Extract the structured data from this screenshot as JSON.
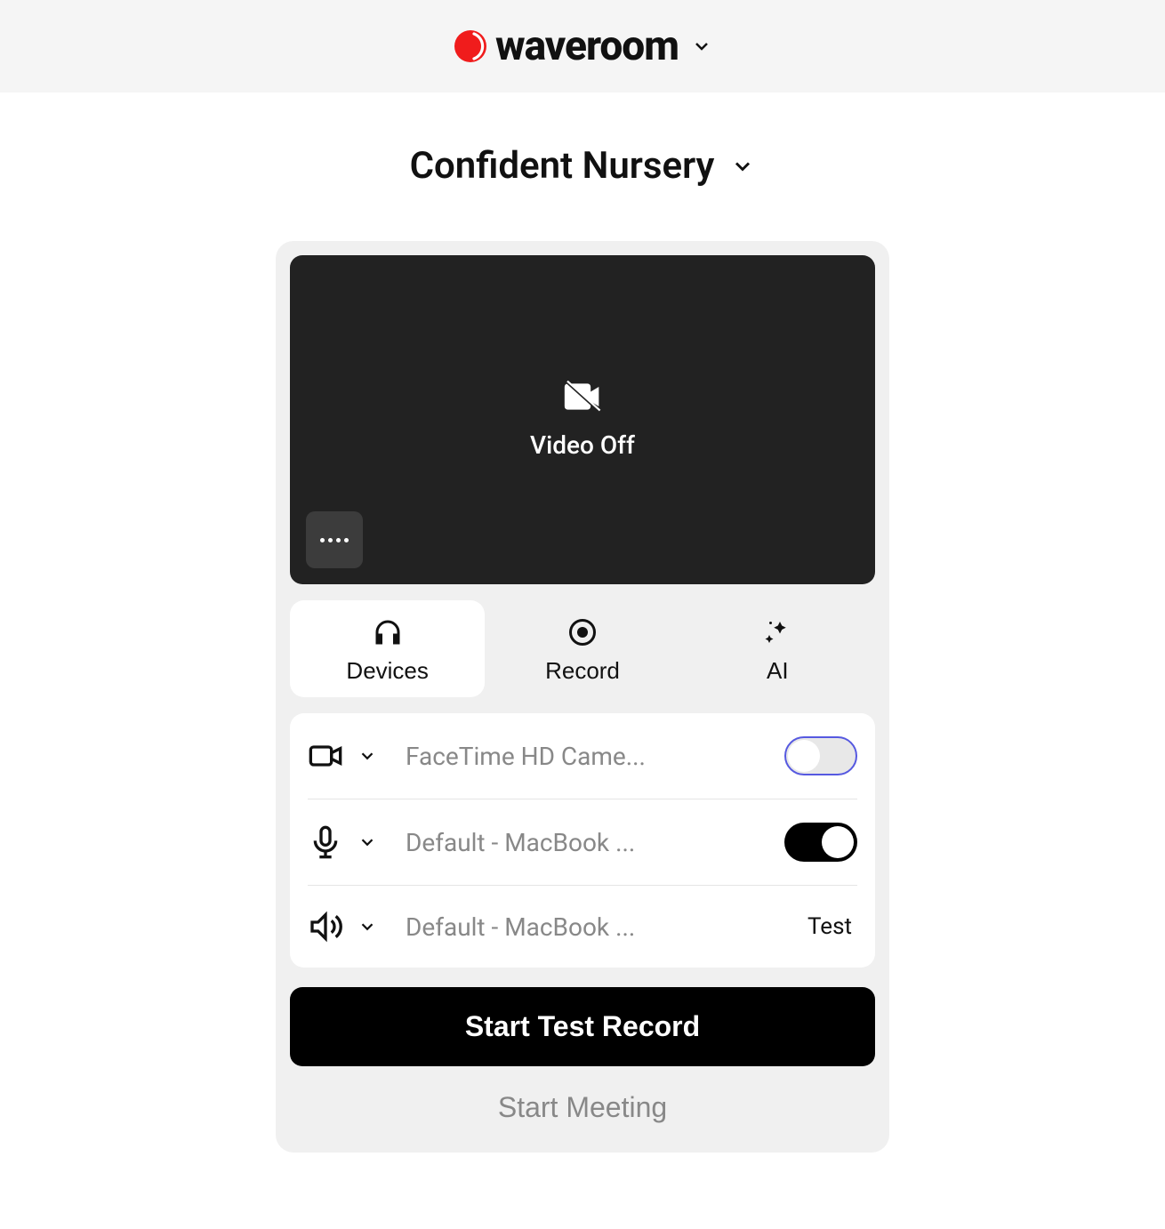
{
  "header": {
    "brand": "waveroom"
  },
  "room": {
    "title": "Confident Nursery"
  },
  "video": {
    "status_label": "Video Off"
  },
  "tabs": [
    {
      "id": "devices",
      "label": "Devices",
      "active": true
    },
    {
      "id": "record",
      "label": "Record",
      "active": false
    },
    {
      "id": "ai",
      "label": "AI",
      "active": false
    }
  ],
  "devices": {
    "camera": {
      "name": "FaceTime HD Came...",
      "enabled": false
    },
    "microphone": {
      "name": "Default - MacBook ...",
      "enabled": true
    },
    "speaker": {
      "name": "Default - MacBook ...",
      "test_label": "Test"
    }
  },
  "actions": {
    "start_test_record": "Start Test Record",
    "start_meeting": "Start Meeting"
  }
}
